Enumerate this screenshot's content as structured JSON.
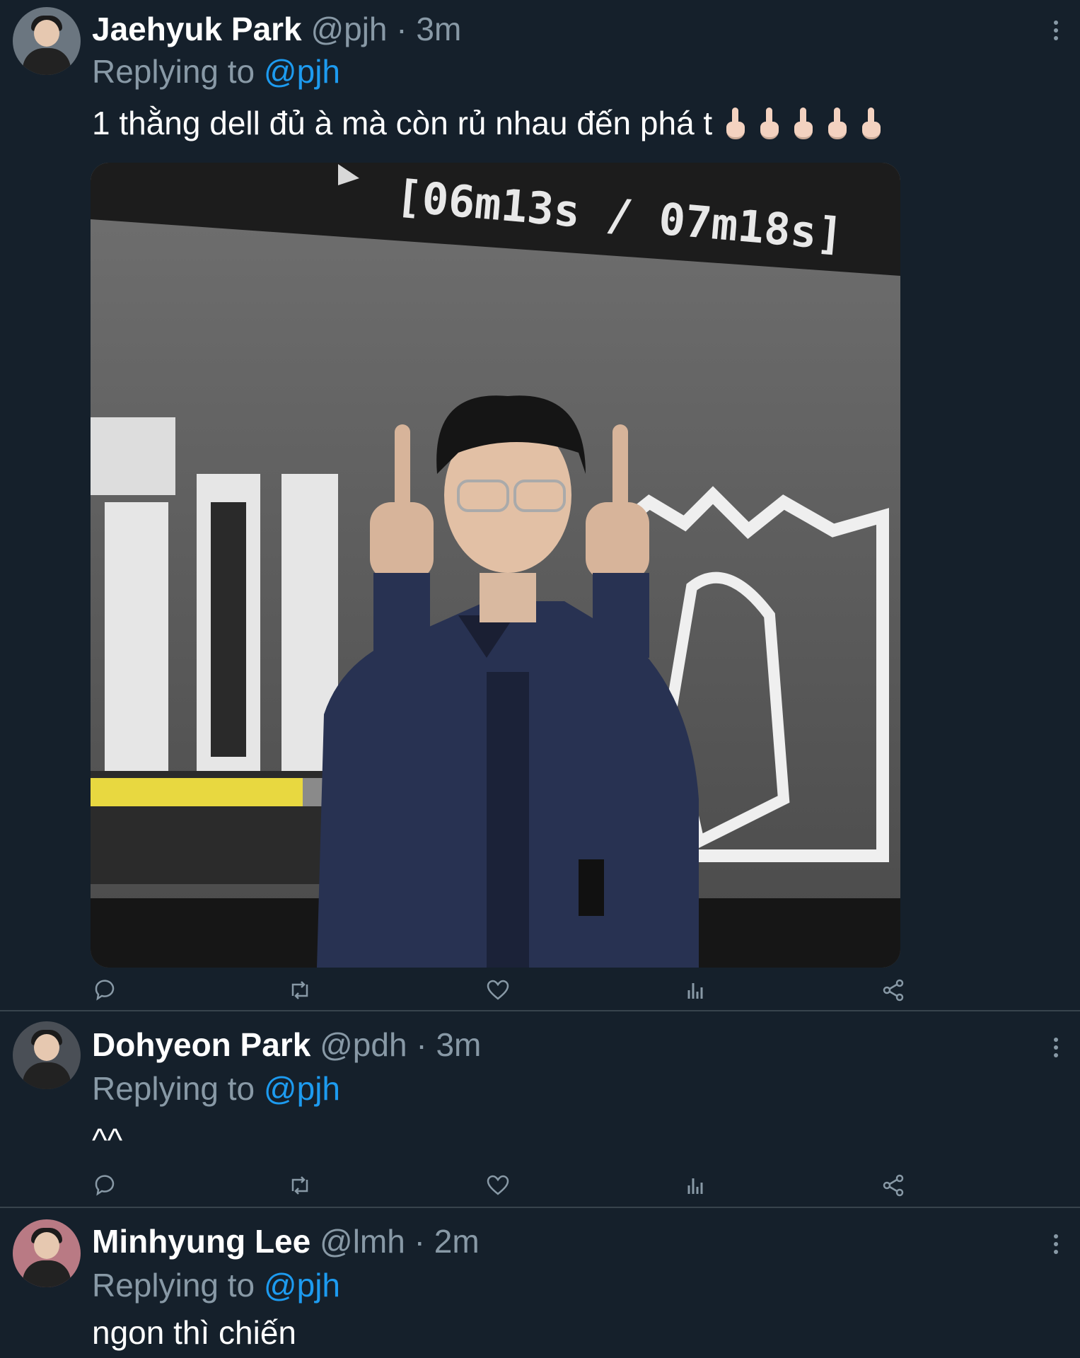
{
  "tweets": [
    {
      "name": "Jaehyuk Park",
      "handle": "@pjh",
      "time": "3m",
      "replying_prefix": "Replying to ",
      "replying_to": "@pjh",
      "text": "1 thằng dell đủ à mà còn rủ nhau đến phá t",
      "emoji_count": 5,
      "media_overlay_text": "[06m13s / 07m18s]"
    },
    {
      "name": "Dohyeon Park",
      "handle": "@pdh",
      "time": "3m",
      "replying_prefix": "Replying to ",
      "replying_to": "@pjh",
      "text": "^^"
    },
    {
      "name": "Minhyung Lee",
      "handle": "@lmh",
      "time": "2m",
      "replying_prefix": "Replying to ",
      "replying_to": "@pjh",
      "text": "ngon thì chiến"
    }
  ],
  "separator": " · ",
  "icons": [
    "reply-icon",
    "retweet-icon",
    "like-icon",
    "analytics-icon",
    "share-icon",
    "more-icon"
  ],
  "colors": {
    "background": "#15202b",
    "secondary_text": "#8899a6",
    "link": "#1d9bf0",
    "divider": "#38444d"
  }
}
